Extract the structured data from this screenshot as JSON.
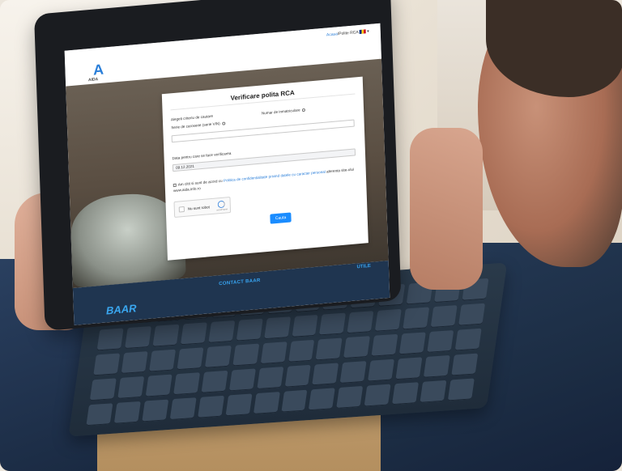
{
  "nav": {
    "logo_glyph": "A",
    "logo_text": "AIDA",
    "link_home": "Acasa",
    "separator": "/",
    "link_policy": "Polite RCA"
  },
  "form": {
    "title": "Verificare polita RCA",
    "criteria_label": "Alegeti criteriu de cautare",
    "option_vin": "Serie de caroserie (serie VIN)",
    "option_plate": "Numar de inmatriculare",
    "date_label": "Data pentru care se face verificarea",
    "date_value": "09.12.2021",
    "agree_prefix": "Am citit si sunt de acord cu",
    "agree_link": "Politica de confidentialitate privind datele cu caracter personal",
    "agree_suffix": "aferenta site-ului www.aida.info.ro",
    "captcha_label": "Nu sunt robot",
    "captcha_brand": "reCAPTCHA",
    "search_button": "Cauta"
  },
  "footer": {
    "contact": "CONTACT BAAR",
    "utile": "UTILE",
    "brand": "BAAR"
  },
  "colors": {
    "accent": "#1a8cff",
    "footer_bg": "#1f3550",
    "link": "#2b7fd9"
  }
}
